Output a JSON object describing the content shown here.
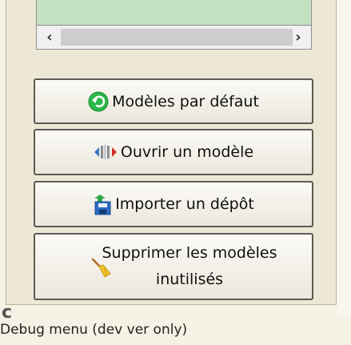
{
  "buttons": {
    "default_models": "Modèles par défaut",
    "open_model": "Ouvrir un modèle",
    "import_repo": "Importer un dépôt",
    "remove_unused": "Supprimer les modèles inutilisés"
  },
  "debug_menu": "Debug menu (dev ver only)",
  "icons": {
    "default_models": "green-undo-icon",
    "open_model": "open-model-icon",
    "import_repo": "import-save-icon",
    "remove_unused": "broom-icon"
  },
  "colors": {
    "list_background": "#c4e2c1",
    "panel": "#ede8d6",
    "icon_green": "#2db84a"
  }
}
